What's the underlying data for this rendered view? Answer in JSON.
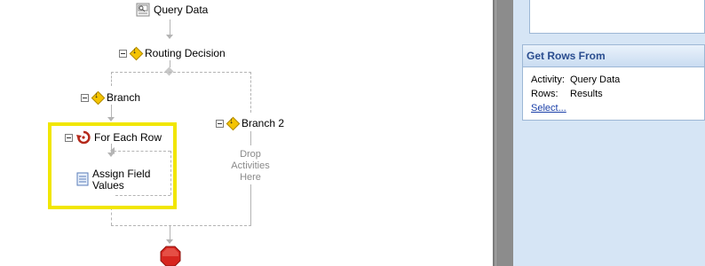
{
  "workflow": {
    "query_data": "Query Data",
    "routing_decision": "Routing Decision",
    "branch": "Branch",
    "branch2": "Branch 2",
    "for_each_row": "For Each Row",
    "assign_field_values_line1": "Assign Field",
    "assign_field_values_line2": "Values",
    "drop_line1": "Drop",
    "drop_line2": "Activities",
    "drop_line3": "Here"
  },
  "properties": {
    "group_title": "Get Rows From",
    "activity_key": "Activity:",
    "activity_value": "Query Data",
    "rows_key": "Rows:",
    "rows_value": "Results",
    "select_link": "Select..."
  },
  "colors": {
    "highlight": "#f1e600",
    "group_title": "#2a4d8f",
    "panel_bg": "#d6e5f5",
    "stop": "#d7261f"
  }
}
